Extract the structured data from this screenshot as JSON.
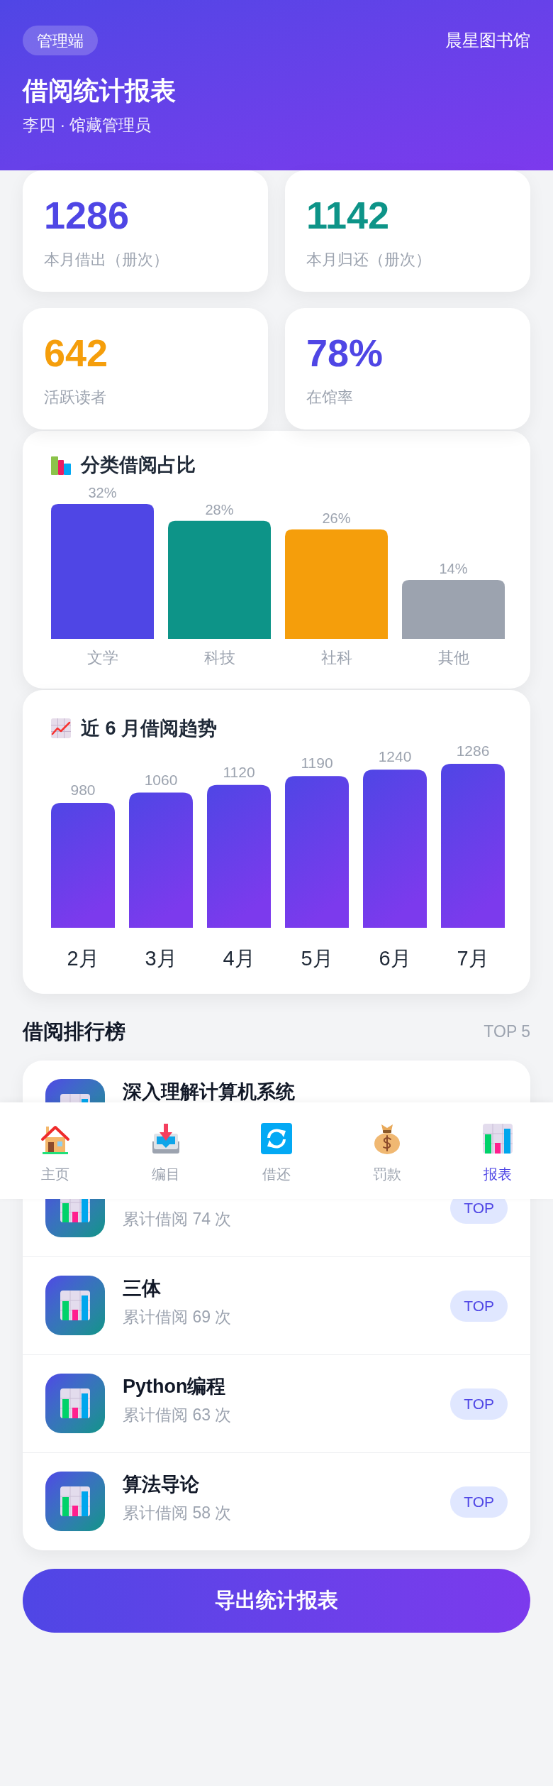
{
  "header": {
    "badge": "管理端",
    "library": "晨星图书馆",
    "title": "借阅统计报表",
    "subtitle": "李四 · 馆藏管理员"
  },
  "stats": [
    {
      "value": "1286",
      "label": "本月借出（册次）",
      "color": "#4f46e5"
    },
    {
      "value": "1142",
      "label": "本月归还（册次）",
      "color": "#0d9488"
    },
    {
      "value": "642",
      "label": "活跃读者",
      "color": "#f59e0b"
    },
    {
      "value": "78%",
      "label": "在馆率",
      "color": "#4f46e5"
    }
  ],
  "category_chart": {
    "bars": [
      {
        "color": "#4f46e5"
      },
      {
        "color": "#0d9488"
      },
      {
        "color": "#f59e0b"
      },
      {
        "color": "#9ca3af"
      }
    ],
    "chart_data": {
      "type": "bar",
      "title": "分类借阅占比",
      "categories": [
        "文学",
        "科技",
        "社科",
        "其他"
      ],
      "values": [
        32,
        28,
        26,
        14
      ],
      "value_labels": [
        "32%",
        "28%",
        "26%",
        "14%"
      ]
    }
  },
  "trend_chart": {
    "chart_data": {
      "type": "bar",
      "title": "近 6 月借阅趋势",
      "categories": [
        "2月",
        "3月",
        "4月",
        "5月",
        "6月",
        "7月"
      ],
      "values": [
        980,
        1060,
        1120,
        1190,
        1240,
        1286
      ],
      "value_labels": [
        "980",
        "1060",
        "1120",
        "1190",
        "1240",
        "1286"
      ]
    }
  },
  "ranking": {
    "title": "借阅排行榜",
    "note": "TOP 5",
    "items": [
      {
        "title": "深入理解计算机系统"
      },
      {
        "count": "累计借阅 74 次",
        "badge": "TOP"
      },
      {
        "title": "三体",
        "count": "累计借阅 69 次",
        "badge": "TOP"
      },
      {
        "title": "Python编程",
        "count": "累计借阅 63 次",
        "badge": "TOP"
      },
      {
        "title": "算法导论",
        "count": "累计借阅 58 次",
        "badge": "TOP"
      }
    ]
  },
  "bottom_nav": [
    {
      "label": "主页",
      "selected": false
    },
    {
      "label": "编目",
      "selected": false
    },
    {
      "label": "借还",
      "selected": false
    },
    {
      "label": "罚款",
      "selected": false
    },
    {
      "label": "报表",
      "selected": true
    }
  ],
  "export_button": "导出统计报表"
}
